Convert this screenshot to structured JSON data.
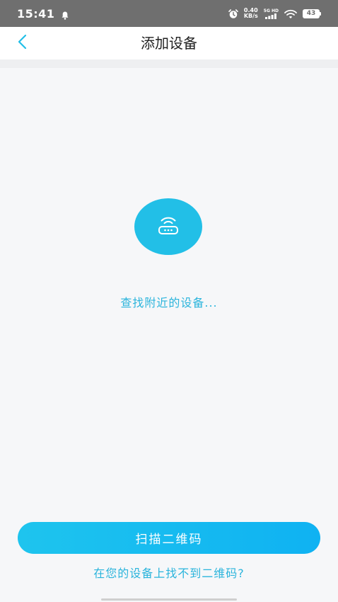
{
  "status_bar": {
    "time": "15:41",
    "speed_value": "0.40",
    "speed_unit": "KB/s",
    "network_type": "5G HD",
    "battery": "43"
  },
  "header": {
    "title": "添加设备"
  },
  "main": {
    "searching_text": "查找附近的设备..."
  },
  "footer": {
    "scan_button_label": "扫描二维码",
    "help_link": "在您的设备上找不到二维码?"
  },
  "icons": {
    "back": "chevron-left-icon",
    "device": "router-wifi-icon"
  },
  "colors": {
    "accent": "#22bfe7",
    "button_gradient_start": "#1ec4ee",
    "button_gradient_end": "#0fb2f2",
    "text_accent": "#2ab4dc",
    "status_bar": "#6f6f6f"
  }
}
